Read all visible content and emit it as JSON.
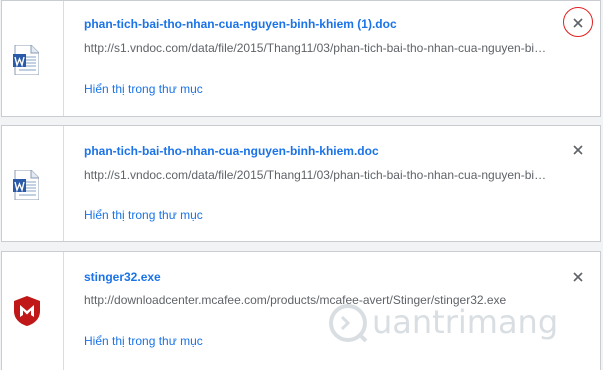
{
  "downloads": [
    {
      "file_name": "phan-tich-bai-tho-nhan-cua-nguyen-binh-khiem (1).doc",
      "url": "http://s1.vndoc.com/data/file/2015/Thang11/03/phan-tich-bai-tho-nhan-cua-nguyen-binh-khiem.doc",
      "show_in_folder_label": "Hiển thị trong thư mục",
      "icon": "word-document-icon"
    },
    {
      "file_name": "phan-tich-bai-tho-nhan-cua-nguyen-binh-khiem.doc",
      "url": "http://s1.vndoc.com/data/file/2015/Thang11/03/phan-tich-bai-tho-nhan-cua-nguyen-binh-khiem.doc",
      "show_in_folder_label": "Hiển thị trong thư mục",
      "icon": "word-document-icon"
    },
    {
      "file_name": "stinger32.exe",
      "url": "http://downloadcenter.mcafee.com/products/mcafee-avert/Stinger/stinger32.exe",
      "show_in_folder_label": "Hiển thị trong thư mục",
      "icon": "mcafee-shield-icon"
    }
  ],
  "watermark": {
    "text": "uantrimang"
  },
  "colors": {
    "link": "#1a73e8",
    "url_text": "#5f6368",
    "highlight": "#e02020",
    "mcafee_red": "#c01818",
    "background": "#f1f3f4"
  }
}
